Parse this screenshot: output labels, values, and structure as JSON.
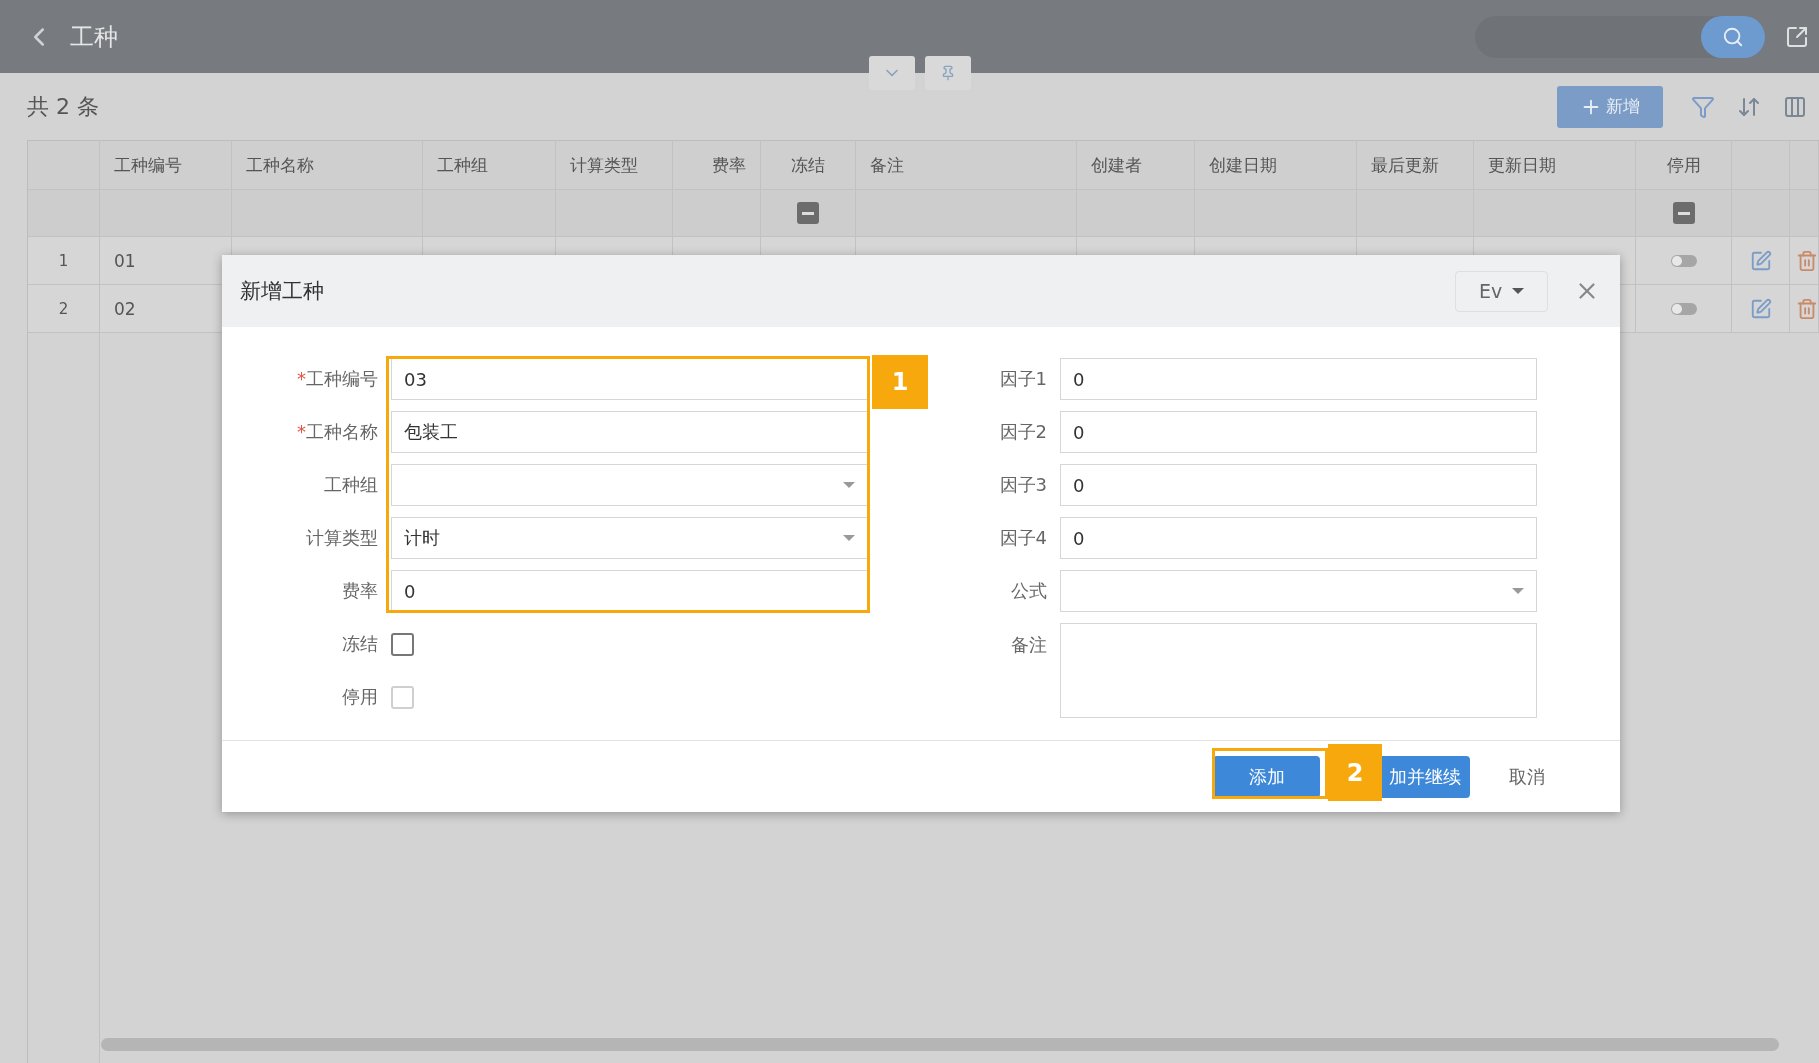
{
  "topbar": {
    "title": "工种"
  },
  "toolbar": {
    "count": "共 2 条",
    "add_button": "新增"
  },
  "table": {
    "columns": [
      "",
      "工种编号",
      "工种名称",
      "工种组",
      "计算类型",
      "费率",
      "冻结",
      "备注",
      "创建者",
      "创建日期",
      "最后更新",
      "更新日期",
      "停用",
      "",
      ""
    ],
    "filter_row": [
      {
        "kind": "blank"
      },
      {
        "kind": "blank"
      },
      {
        "kind": "blank"
      },
      {
        "kind": "blank"
      },
      {
        "kind": "blank"
      },
      {
        "kind": "blank"
      },
      {
        "kind": "tristate",
        "indeterminate": true
      },
      {
        "kind": "blank"
      },
      {
        "kind": "blank"
      },
      {
        "kind": "blank"
      },
      {
        "kind": "blank"
      },
      {
        "kind": "blank"
      },
      {
        "kind": "tristate",
        "indeterminate": true
      },
      {
        "kind": "blank"
      },
      {
        "kind": "blank"
      }
    ],
    "rows": [
      {
        "index": "1",
        "code": "01",
        "on": false
      },
      {
        "index": "2",
        "code": "02",
        "on": false
      }
    ]
  },
  "dialog": {
    "title": "新增工种",
    "language": "Ev",
    "left_fields": [
      {
        "kind": "text",
        "label": "工种编号",
        "mark": "*",
        "value": "03"
      },
      {
        "kind": "text",
        "label": "工种名称",
        "mark": "*",
        "value": "包装工"
      },
      {
        "kind": "select",
        "label": "工种组"
      },
      {
        "kind": "select",
        "label": "计算类型",
        "value": "计时"
      },
      {
        "kind": "text",
        "label": "费率",
        "value": "0"
      },
      {
        "kind": "checkbox",
        "label": "冻结",
        "checked": false,
        "disabled": false
      },
      {
        "kind": "checkbox",
        "label": "停用",
        "checked": false,
        "disabled": true
      }
    ],
    "right_fields": [
      {
        "kind": "text",
        "label": "因子1",
        "value": "0"
      },
      {
        "kind": "text",
        "label": "因子2",
        "value": "0"
      },
      {
        "kind": "text",
        "label": "因子3",
        "value": "0"
      },
      {
        "kind": "text",
        "label": "因子4",
        "value": "0"
      },
      {
        "kind": "select",
        "label": "公式"
      },
      {
        "kind": "textarea",
        "label": "备注"
      }
    ],
    "buttons": [
      {
        "kind": "primary",
        "label": "添加"
      },
      {
        "kind": "primary",
        "label": "加并继续"
      },
      {
        "kind": "plain",
        "label": "取消"
      }
    ]
  },
  "annotations": [
    {
      "label": "1"
    },
    {
      "label": "2"
    }
  ]
}
